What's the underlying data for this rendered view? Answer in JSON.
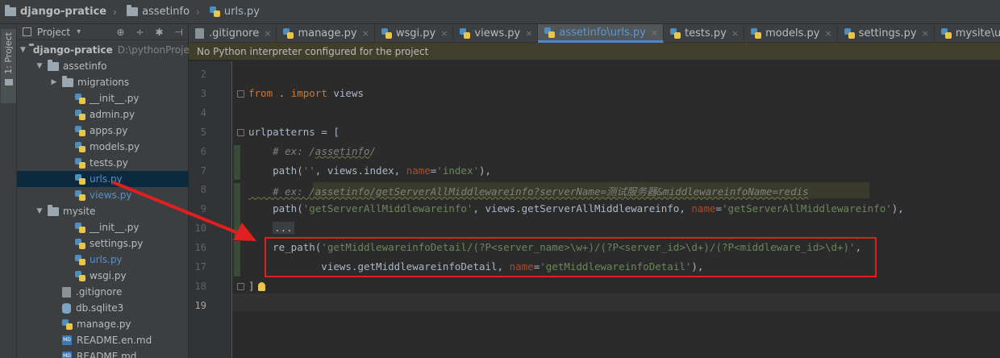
{
  "breadcrumbs": [
    "django-pratice",
    "assetinfo",
    "urls.py"
  ],
  "toolwindow": {
    "tab_label": "1: Project"
  },
  "project_panel": {
    "header": "Project",
    "dropdown_glyph": "▾",
    "buttons": [
      "⊕",
      "÷",
      "✱",
      "⊣"
    ]
  },
  "tree": [
    {
      "label": "django-pratice",
      "extra": "D:\\pythonProjec",
      "type": "folder",
      "depth": 0,
      "expanded": true
    },
    {
      "label": "assetinfo",
      "type": "folder",
      "depth": 1,
      "expanded": true
    },
    {
      "label": "migrations",
      "type": "folder",
      "depth": 2,
      "expanded": false
    },
    {
      "label": "__init__.py",
      "type": "py",
      "depth": 3
    },
    {
      "label": "admin.py",
      "type": "py",
      "depth": 3
    },
    {
      "label": "apps.py",
      "type": "py",
      "depth": 3
    },
    {
      "label": "models.py",
      "type": "py",
      "depth": 3
    },
    {
      "label": "tests.py",
      "type": "py",
      "depth": 3
    },
    {
      "label": "urls.py",
      "type": "py",
      "depth": 3,
      "selected": true,
      "open": true
    },
    {
      "label": "views.py",
      "type": "py",
      "depth": 3,
      "open": true
    },
    {
      "label": "mysite",
      "type": "folder",
      "depth": 1,
      "expanded": true
    },
    {
      "label": "__init__.py",
      "type": "py",
      "depth": 3
    },
    {
      "label": "settings.py",
      "type": "py",
      "depth": 3
    },
    {
      "label": "urls.py",
      "type": "py",
      "depth": 3,
      "open": true
    },
    {
      "label": "wsgi.py",
      "type": "py",
      "depth": 3
    },
    {
      "label": ".gitignore",
      "type": "txt",
      "depth": 2
    },
    {
      "label": "db.sqlite3",
      "type": "db",
      "depth": 2
    },
    {
      "label": "manage.py",
      "type": "py",
      "depth": 2
    },
    {
      "label": "README.en.md",
      "type": "md",
      "depth": 2
    },
    {
      "label": "README.md",
      "type": "md",
      "depth": 2
    }
  ],
  "tabs": [
    {
      "label": ".gitignore",
      "type": "txt"
    },
    {
      "label": "manage.py",
      "type": "py"
    },
    {
      "label": "wsgi.py",
      "type": "py"
    },
    {
      "label": "views.py",
      "type": "py"
    },
    {
      "label": "assetinfo\\urls.py",
      "type": "py",
      "active": true
    },
    {
      "label": "tests.py",
      "type": "py"
    },
    {
      "label": "models.py",
      "type": "py"
    },
    {
      "label": "settings.py",
      "type": "py"
    },
    {
      "label": "mysite\\urls.py",
      "type": "py"
    }
  ],
  "tab_close_glyph": "×",
  "banner": "No Python interpreter configured for the project",
  "editor": {
    "current_line": "19",
    "lines": [
      {
        "num": "2",
        "tokens": []
      },
      {
        "num": "3",
        "tokens": [
          [
            "kw",
            "from"
          ],
          [
            "tx",
            " . "
          ],
          [
            "kw",
            "import"
          ],
          [
            "tx",
            " views"
          ]
        ]
      },
      {
        "num": "4",
        "tokens": []
      },
      {
        "num": "5",
        "tokens": [
          [
            "tx",
            "urlpatterns = ["
          ]
        ]
      },
      {
        "num": "6",
        "tokens": [
          [
            "cm",
            "    # ex: /"
          ],
          [
            "cm-u",
            "assetinfo"
          ],
          [
            "cm",
            "/"
          ]
        ]
      },
      {
        "num": "7",
        "tokens": [
          [
            "tx",
            "    path("
          ],
          [
            "st",
            "''"
          ],
          [
            "tx",
            ", views.index, "
          ],
          [
            "nm",
            "name"
          ],
          [
            "tx",
            "="
          ],
          [
            "st",
            "'index'"
          ],
          [
            "tx",
            "),"
          ]
        ]
      },
      {
        "num": "8",
        "tokens": [
          [
            "cm-u",
            "    # ex: /assetinfo/getServerAllMiddlewareinfo?serverName=测试服务器&middlewareinfoName=redis"
          ]
        ]
      },
      {
        "num": "9",
        "tokens": [
          [
            "tx",
            "    path("
          ],
          [
            "st",
            "'getServerAllMiddlewareinfo'"
          ],
          [
            "tx",
            ", views.getServerAllMiddlewareinfo, "
          ],
          [
            "nm",
            "name"
          ],
          [
            "tx",
            "="
          ],
          [
            "st",
            "'getServerAllMiddlewareinfo'"
          ],
          [
            "tx",
            "),"
          ]
        ]
      },
      {
        "num": "10",
        "tokens": [
          [
            "tx",
            "    "
          ],
          [
            "fo",
            "..."
          ]
        ]
      },
      {
        "num": "16",
        "tokens": [
          [
            "tx",
            "    re_path("
          ],
          [
            "st",
            "'getMiddlewareinfoDetail/(?P<server_name>\\w+)/(?P<server_id>\\d+)/(?P<middleware_id>\\d+)'"
          ],
          [
            "tx",
            ","
          ]
        ]
      },
      {
        "num": "17",
        "tokens": [
          [
            "tx",
            "            views.getMiddlewareinfoDetail, "
          ],
          [
            "nm",
            "name"
          ],
          [
            "tx",
            "="
          ],
          [
            "st",
            "'getMiddlewareinfoDetail'"
          ],
          [
            "tx",
            "),"
          ]
        ]
      },
      {
        "num": "18",
        "tokens": [
          [
            "tx",
            "]"
          ]
        ]
      },
      {
        "num": "19",
        "tokens": []
      }
    ]
  },
  "colors": {
    "annotation": "#e02020",
    "keyword": "#cc7832",
    "string": "#6a8759",
    "comment": "#808080",
    "param": "#aa4926",
    "active_tab": "#5d97d1"
  }
}
